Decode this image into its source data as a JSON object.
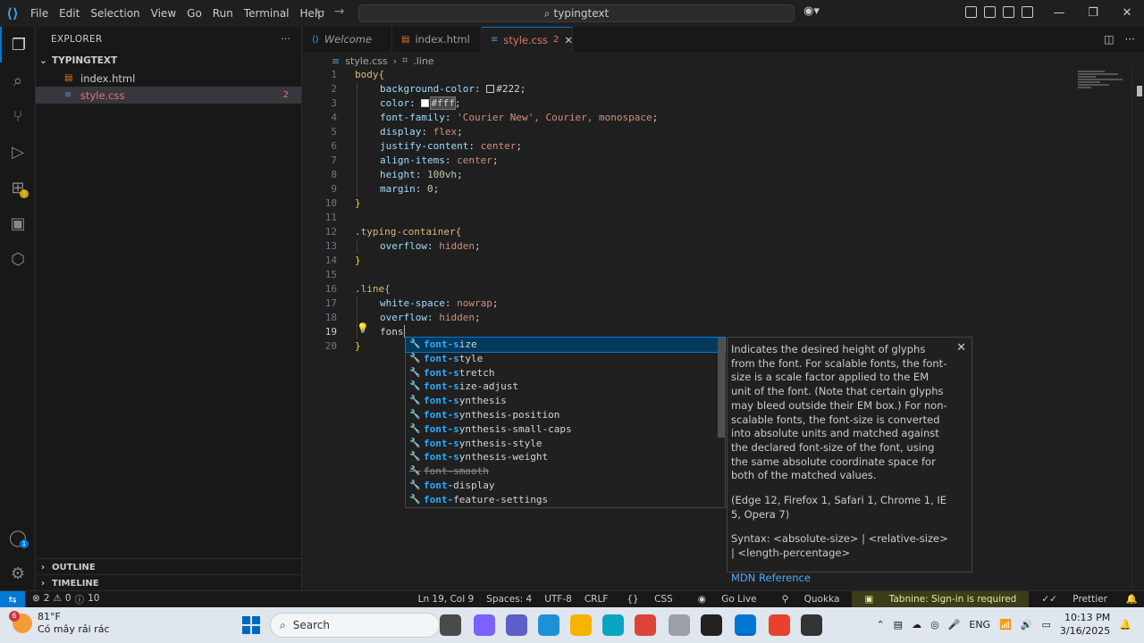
{
  "titlebar": {
    "menu": [
      "File",
      "Edit",
      "Selection",
      "View",
      "Go",
      "Run",
      "Terminal",
      "Help"
    ],
    "search": "typingtext"
  },
  "explorer": {
    "title": "EXPLORER",
    "folder": "TYPINGTEXT",
    "files": [
      {
        "name": "index.html",
        "icon": "html-file-icon"
      },
      {
        "name": "style.css",
        "icon": "css-file-icon",
        "problems": "2"
      }
    ],
    "outline": "OUTLINE",
    "timeline": "TIMELINE"
  },
  "tabs": [
    {
      "label": "Welcome"
    },
    {
      "label": "index.html"
    },
    {
      "label": "style.css",
      "count": "2"
    }
  ],
  "breadcrumb": {
    "file": "style.css",
    "symbol": ".line"
  },
  "editor": {
    "lines": [
      {
        "n": "1"
      },
      {
        "n": "2"
      },
      {
        "n": "3"
      },
      {
        "n": "4"
      },
      {
        "n": "5"
      },
      {
        "n": "6"
      },
      {
        "n": "7"
      },
      {
        "n": "8"
      },
      {
        "n": "9"
      },
      {
        "n": "10"
      },
      {
        "n": "11"
      },
      {
        "n": "12"
      },
      {
        "n": "13"
      },
      {
        "n": "14"
      },
      {
        "n": "15"
      },
      {
        "n": "16"
      },
      {
        "n": "17"
      },
      {
        "n": "18"
      },
      {
        "n": "19"
      },
      {
        "n": "20"
      }
    ],
    "code": {
      "l1": "body{",
      "l2p": "background-color",
      "l2v": "#222",
      "l3p": "color",
      "l3v": "#fff",
      "l4p": "font-family",
      "l4v": "'Courier New', Courier, monospace",
      "l5p": "display",
      "l5v": "flex",
      "l6p": "justify-content",
      "l6v": "center",
      "l7p": "align-items",
      "l7v": "center",
      "l8p": "height",
      "l8v": "100vh",
      "l9p": "margin",
      "l9v": "0",
      "l10": "}",
      "l12": ".typing-container{",
      "l13p": "overflow",
      "l13v": "hidden",
      "l14": "}",
      "l16": ".line{",
      "l17p": "white-space",
      "l17v": "nowrap",
      "l18p": "overflow",
      "l18v": "hidden",
      "l19": "fons",
      "l20": "}"
    }
  },
  "suggestions": [
    {
      "pre": "",
      "hl": "font-s",
      "post": "ize",
      "focused": true
    },
    {
      "pre": "",
      "hl": "font-s",
      "post": "tyle"
    },
    {
      "pre": "",
      "hl": "font-s",
      "post": "tretch"
    },
    {
      "pre": "",
      "hl": "font-s",
      "post": "ize-adjust"
    },
    {
      "pre": "",
      "hl": "font-s",
      "post": "ynthesis"
    },
    {
      "pre": "",
      "hl": "font-s",
      "post": "ynthesis-position"
    },
    {
      "pre": "",
      "hl": "font-s",
      "post": "ynthesis-small-caps"
    },
    {
      "pre": "",
      "hl": "font-s",
      "post": "ynthesis-style"
    },
    {
      "pre": "",
      "hl": "font-s",
      "post": "ynthesis-weight"
    },
    {
      "pre": "",
      "hl": "font-s",
      "post": "mooth",
      "deprecated": true
    },
    {
      "pre": "",
      "hl": "font-",
      "post": "display"
    },
    {
      "pre": "",
      "hl": "font-",
      "post": "feature-settings"
    }
  ],
  "details": {
    "desc": "Indicates the desired height of glyphs from the font. For scalable fonts, the font-size is a scale factor applied to the EM unit of the font. (Note that certain glyphs may bleed outside their EM box.) For non-scalable fonts, the font-size is converted into absolute units and matched against the declared font-size of the font, using the same absolute coordinate space for both of the matched values.",
    "browsers": "(Edge 12, Firefox 1, Safari 1, Chrome 1, IE 5, Opera 7)",
    "syntax": "Syntax: <absolute-size> | <relative-size> | <length-percentage>",
    "ref": "MDN Reference"
  },
  "statusbar": {
    "problems": "2",
    "warnings": "0",
    "info": "10",
    "position": "Ln 19, Col 9",
    "spaces": "Spaces: 4",
    "encoding": "UTF-8",
    "eol": "CRLF",
    "language": "CSS",
    "golive": "Go Live",
    "quokka": "Quokka",
    "tabnine": "Tabnine: Sign-in is required",
    "prettier": "Prettier"
  },
  "taskbar": {
    "temp": "81°F",
    "weather": "Có mây rải rác",
    "weather_badge": "6",
    "search": "Search",
    "lang": "ENG",
    "time": "10:13 PM",
    "date": "3/16/2025"
  },
  "colors": {
    "accent": "#0078d4",
    "tabnine_bg": "#3c3c1a"
  }
}
